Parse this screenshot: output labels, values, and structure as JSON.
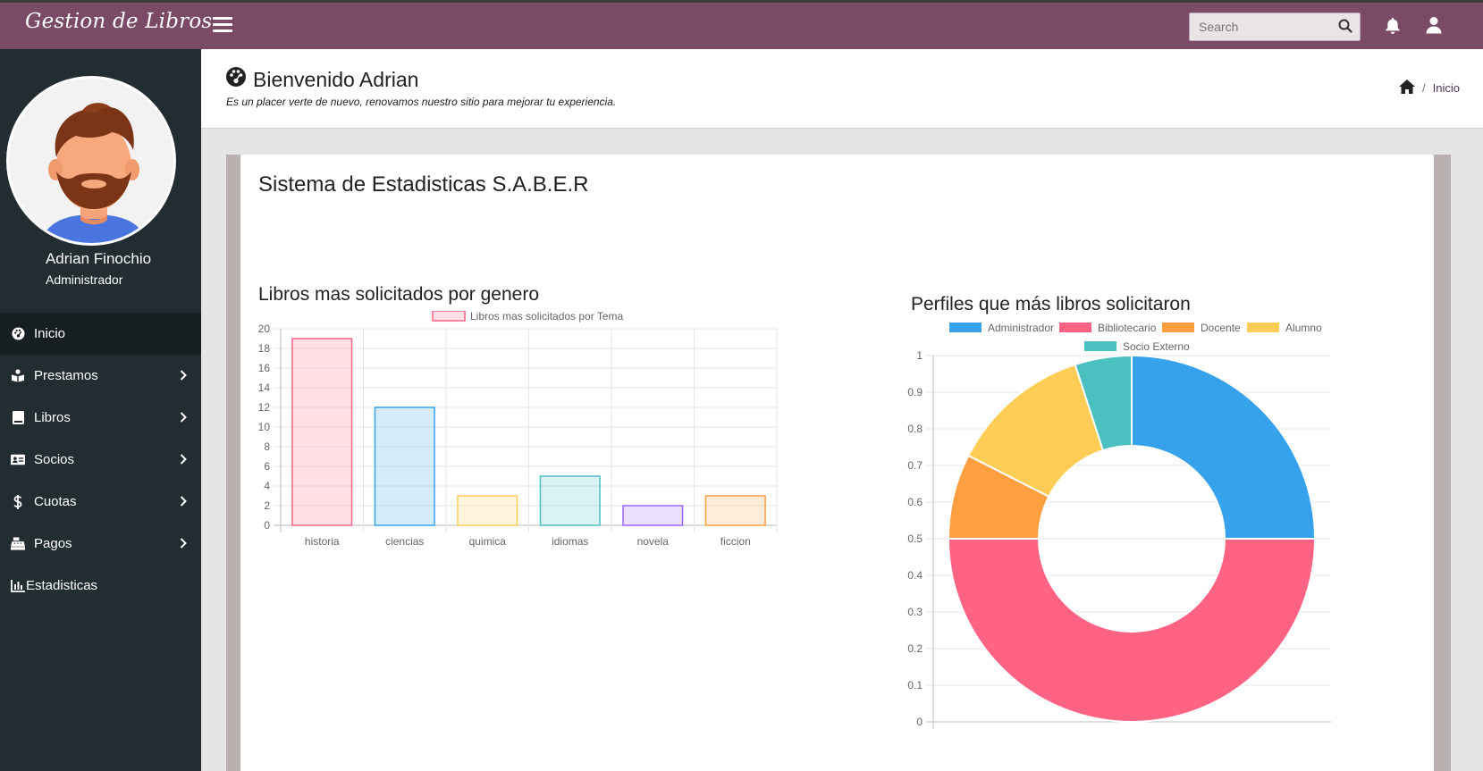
{
  "app": {
    "brand": "Gestion de Libros"
  },
  "topbar": {
    "search_placeholder": "Search",
    "icons": [
      "menu-icon",
      "search-icon",
      "bell-icon",
      "user-icon"
    ]
  },
  "user": {
    "name": "Adrian Finochio",
    "role": "Administrador"
  },
  "sidebar": {
    "items": [
      {
        "label": "Inicio",
        "icon": "dashboard-icon",
        "active": true,
        "has_submenu": false
      },
      {
        "label": "Prestamos",
        "icon": "book-reader-icon",
        "active": false,
        "has_submenu": true
      },
      {
        "label": "Libros",
        "icon": "book-icon",
        "active": false,
        "has_submenu": true
      },
      {
        "label": "Socios",
        "icon": "id-card-icon",
        "active": false,
        "has_submenu": true
      },
      {
        "label": "Cuotas",
        "icon": "dollar-icon",
        "active": false,
        "has_submenu": true
      },
      {
        "label": "Pagos",
        "icon": "cash-register-icon",
        "active": false,
        "has_submenu": true
      },
      {
        "label": "Estadisticas",
        "icon": "chart-icon",
        "active": false,
        "has_submenu": false
      }
    ]
  },
  "header": {
    "title": "Bienvenido Adrian",
    "subtitle": "Es un placer verte de nuevo, renovamos nuestro sitio para mejorar tu experiencia.",
    "breadcrumb": {
      "home_icon": "home-icon",
      "current": "Inicio"
    }
  },
  "main": {
    "card_title": "Sistema de Estadisticas S.A.B.E.R",
    "bar_chart_heading": "Libros mas solicitados por genero",
    "doughnut_chart_heading": "Perfiles que más libros solicitaron"
  },
  "colors": {
    "topbar": "#7a4a66",
    "sidebar": "#222d32",
    "sidebar_active": "#171e21"
  },
  "chart_data": [
    {
      "type": "bar",
      "title": "",
      "categories": [
        "historia",
        "ciencias",
        "quimica",
        "idiomas",
        "novela",
        "ficcion"
      ],
      "series": [
        {
          "name": "Libros mas solicitados por Tema",
          "values": [
            19,
            12,
            3,
            5,
            2,
            3
          ]
        }
      ],
      "bar_fill_colors": [
        "rgba(255,99,132,0.2)",
        "rgba(54,162,235,0.2)",
        "rgba(255,206,86,0.2)",
        "rgba(75,192,192,0.2)",
        "rgba(153,102,255,0.2)",
        "rgba(255,159,64,0.2)"
      ],
      "bar_border_colors": [
        "#ff6384",
        "#36a2eb",
        "#ffce56",
        "#4bc0c0",
        "#9966ff",
        "#ff9f40"
      ],
      "yticks": [
        "0",
        "2",
        "4",
        "6",
        "8",
        "10",
        "12",
        "14",
        "16",
        "18",
        "20"
      ],
      "ylim": [
        0,
        20
      ],
      "grid": true,
      "legend": "top-center"
    },
    {
      "type": "pie",
      "variant": "doughnut",
      "title": "",
      "labels": [
        "Administrador",
        "Bibliotecario",
        "Docente",
        "Alumno",
        "Socio Externo"
      ],
      "values": [
        10,
        20,
        3,
        5,
        2
      ],
      "colors": [
        "#36a2eb",
        "#ff6384",
        "#ff9f40",
        "#ffcd56",
        "#4bc0c0"
      ],
      "yticks": [
        "0",
        "0.1",
        "0.2",
        "0.3",
        "0.4",
        "0.5",
        "0.6",
        "0.7",
        "0.8",
        "0.9",
        "1"
      ],
      "ylim": [
        0,
        1
      ],
      "grid": true,
      "legend": "top-center"
    }
  ]
}
